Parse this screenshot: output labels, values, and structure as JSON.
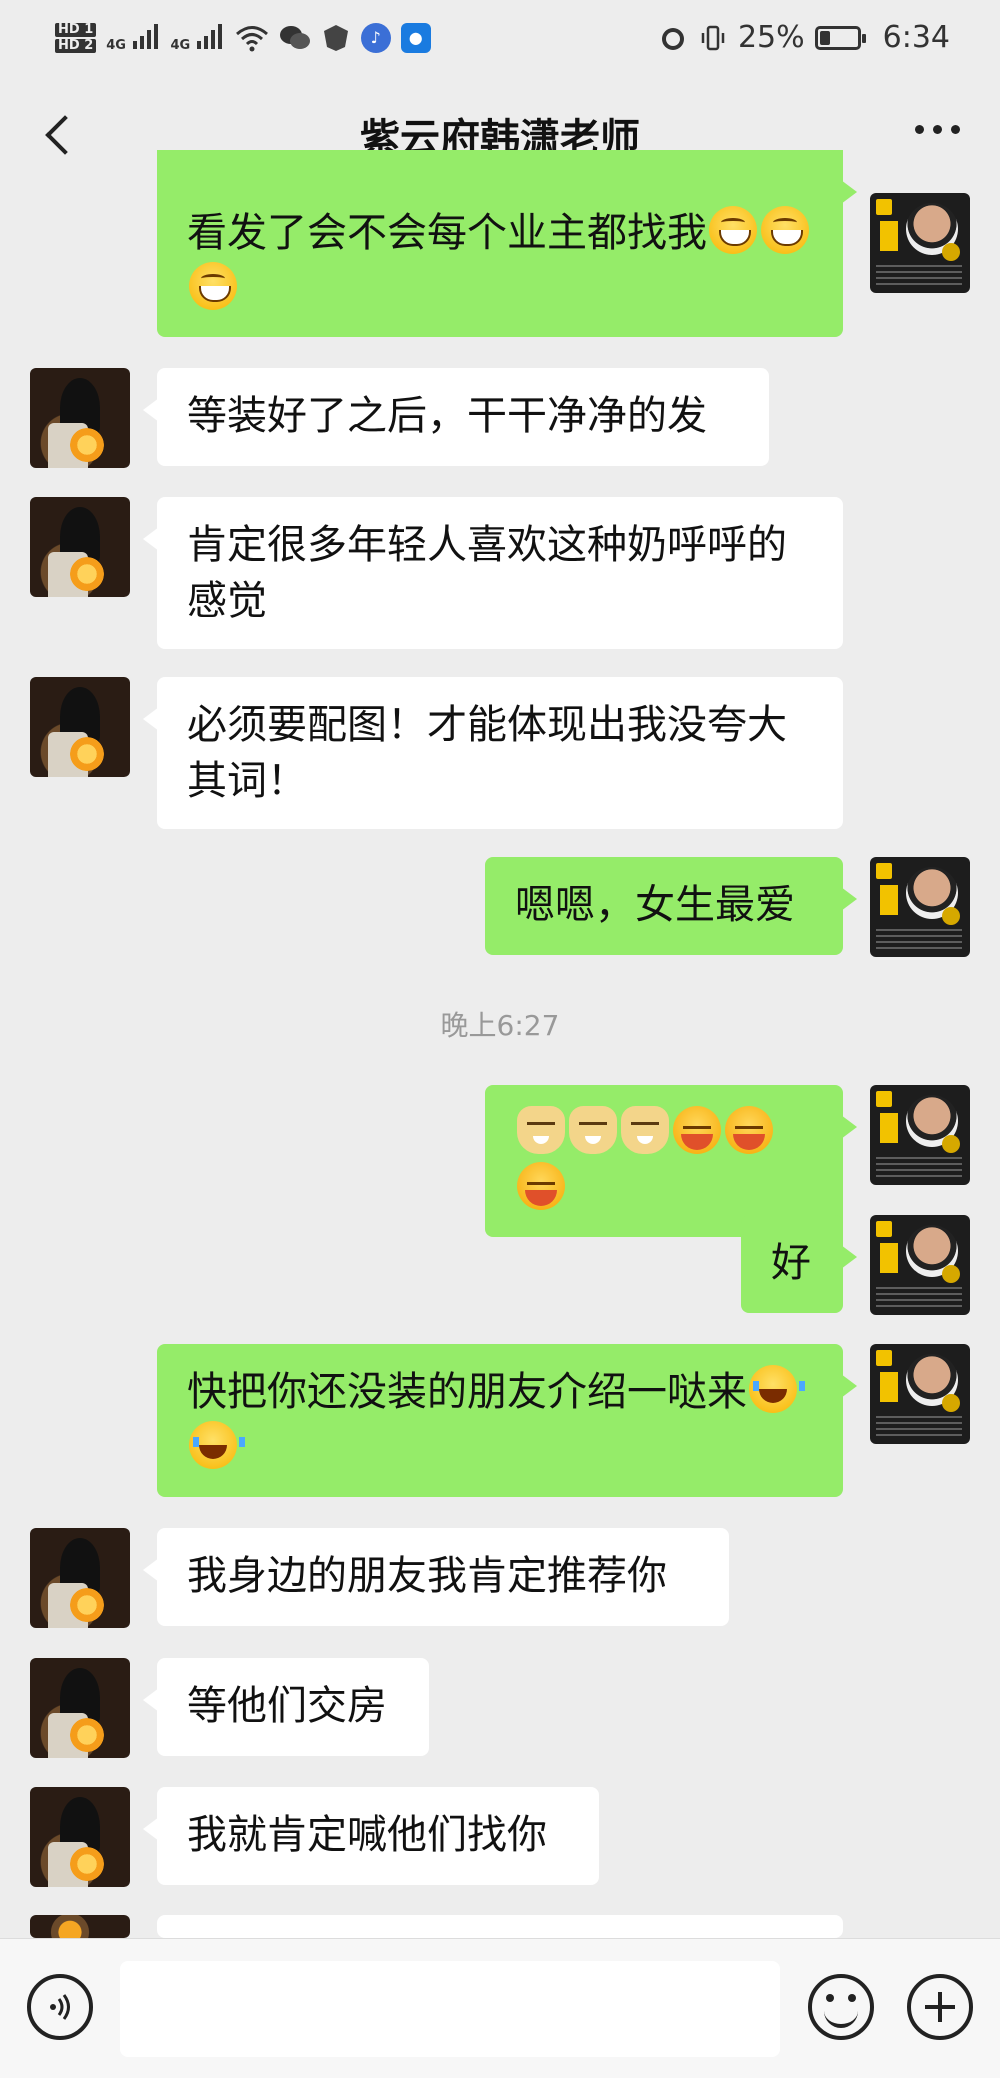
{
  "status_bar": {
    "hd1": "HD 1",
    "hd2": "HD 2",
    "net1": "4G",
    "net2": "4G",
    "battery_percent_text": "25%",
    "battery_level": 0.25,
    "time": "6:34"
  },
  "header": {
    "title": "紫云府韩潇老师"
  },
  "messages": [
    {
      "from": "me",
      "text": "看发了会不会每个业主都找我",
      "emoji": [
        "grin",
        "grin",
        "grin"
      ]
    },
    {
      "from": "them",
      "text": "等装好了之后，干干净净的发"
    },
    {
      "from": "them",
      "text": "肯定很多年轻人喜欢这种奶呼呼的感觉"
    },
    {
      "from": "them",
      "text": "必须要配图！才能体现出我没夸大其词！"
    },
    {
      "from": "me",
      "text": "嗯嗯，女生最爱"
    },
    {
      "from": "me",
      "text": "",
      "emoji": [
        "doge",
        "doge",
        "doge",
        "shy",
        "shy",
        "shy"
      ]
    },
    {
      "from": "me",
      "text": "好"
    },
    {
      "from": "me",
      "text": "快把你还没装的朋友介绍一哒来",
      "emoji": [
        "laugh",
        "laugh"
      ]
    },
    {
      "from": "them",
      "text": "我身边的朋友我肯定推荐你"
    },
    {
      "from": "them",
      "text": "等他们交房"
    },
    {
      "from": "them",
      "text": "我就肯定喊他们找你"
    }
  ],
  "timestamp": "晚上6:27",
  "input": {
    "value": "",
    "placeholder": ""
  },
  "icons": {
    "back": "back-chevron-icon",
    "more": "more-dots-icon",
    "voice": "voice-icon",
    "emoji": "emoji-icon",
    "plus": "plus-icon"
  }
}
